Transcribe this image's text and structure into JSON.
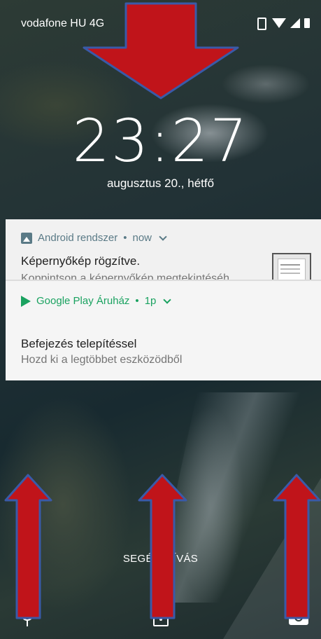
{
  "status_bar": {
    "carrier": "vodafone HU 4G",
    "icons": [
      "vibrate-icon",
      "wifi-icon",
      "signal-icon",
      "battery-icon"
    ]
  },
  "lockscreen": {
    "time": "23:27",
    "date": "augusztus 20., hétfő",
    "emergency_label": "SEGÉLYHÍVÁS"
  },
  "notifications": [
    {
      "app": "Android rendszer",
      "time": "now",
      "icon": "image-icon",
      "title": "Képernyőkép rögzítve.",
      "text": "Koppintson a képernyőkép megtekintéséh..",
      "accent": "#5a7a86"
    },
    {
      "app": "Google Play Áruház",
      "time": "1p",
      "icon": "google-play-icon",
      "title": "Befejezés telepítéssel",
      "text": "Hozd ki a legtöbbet eszközödből",
      "accent": "#1aa260"
    }
  ],
  "bottom_actions": [
    "microphone-icon",
    "unlock-icon",
    "camera-icon"
  ],
  "annotation": {
    "arrow_fill": "#c0141a",
    "arrow_stroke": "#3a5aa8"
  }
}
